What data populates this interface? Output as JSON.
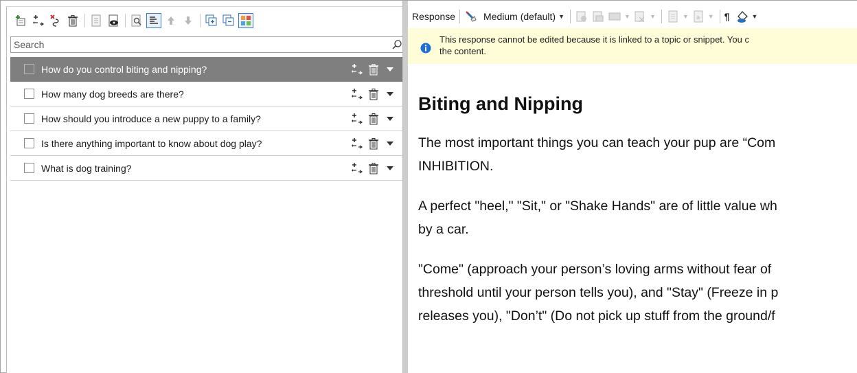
{
  "left_toolbar": {
    "icons": [
      "add-topic-icon",
      "add-response-icon",
      "remove-link-icon",
      "delete-icon",
      "document-icon",
      "preview-icon",
      "find-icon",
      "align-icon",
      "move-up-icon",
      "move-down-icon",
      "expand-all-icon",
      "collapse-all-icon",
      "color-grid-icon"
    ]
  },
  "search": {
    "placeholder": "Search"
  },
  "questions": [
    {
      "text": "How do you control biting and nipping?",
      "selected": true
    },
    {
      "text": "How many dog breeds are there?",
      "selected": false
    },
    {
      "text": "How should you introduce a new puppy to a family?",
      "selected": false
    },
    {
      "text": "Is there anything important to know about dog play?",
      "selected": false
    },
    {
      "text": "What is dog training?",
      "selected": false
    }
  ],
  "right_toolbar": {
    "response_label": "Response",
    "style_select": "Medium (default)",
    "pilcrow": "¶"
  },
  "notice": {
    "line1": "This response cannot be edited because it is linked to a topic or snippet. You c",
    "line2": "the content."
  },
  "content": {
    "heading": "Biting and Nipping",
    "p1_line1": "The most important things you can teach your pup are “Com",
    "p1_line2": "INHIBITION.",
    "p2_line1": "A perfect \"heel,\" \"Sit,\" or \"Shake Hands\" are of little value wh",
    "p2_line2": "by a car.",
    "p3_line1": "\"Come\" (approach your person’s loving arms without fear of",
    "p3_line2": "threshold until your person tells you), and \"Stay\" (Freeze in p",
    "p3_line3": "releases you), \"Don’t\" (Do not pick up stuff from the ground/f"
  },
  "colors": {
    "selected_row_bg": "#7f7f7f",
    "notice_bg": "#fffdd8",
    "info_blue": "#1e6fd9",
    "splitter": "#cdcdcd"
  }
}
